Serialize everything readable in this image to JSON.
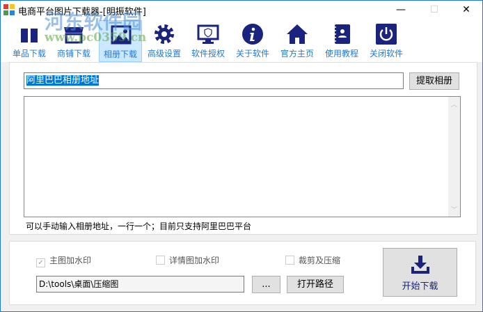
{
  "window": {
    "title": "电商平台图片下载器-[明振软件]",
    "minimize": "—",
    "maximize": "☐",
    "close": "✕"
  },
  "toolbar": [
    {
      "label": "单品下载",
      "icon": "box-icon"
    },
    {
      "label": "商铺下载",
      "icon": "store-icon"
    },
    {
      "label": "相册下载",
      "icon": "image-icon",
      "selected": true
    },
    {
      "label": "高级设置",
      "icon": "gear-icon"
    },
    {
      "label": "软件授权",
      "icon": "monitor-shield-icon"
    },
    {
      "label": "关于软件",
      "icon": "info-icon"
    },
    {
      "label": "官方主页",
      "icon": "home-icon"
    },
    {
      "label": "使用教程",
      "icon": "notebook-icon"
    },
    {
      "label": "关闭软件",
      "icon": "power-icon"
    }
  ],
  "album": {
    "url_value": "阿里巴巴相册地址",
    "fetch_button": "提取相册",
    "list_text": "",
    "hint": "可以手动输入相册地址，一行一个；目前只支持阿里巴巴平台"
  },
  "options": {
    "main_watermark": {
      "label": "主图加水印",
      "checked": true
    },
    "detail_watermark": {
      "label": "详情图加水印",
      "checked": false
    },
    "crop_compress": {
      "label": "裁剪及压缩",
      "checked": false
    }
  },
  "path": {
    "value": "D:\\tools\\桌面\\压缩图",
    "browse_button": "...",
    "open_button": "打开路径"
  },
  "start_button": "开始下载",
  "watermark": {
    "name": "河东软件园",
    "url": "www.pc0359.cn"
  },
  "colors": {
    "accent": "#1e7ad8",
    "icon": "#1a237e",
    "selected": "#cce8ff"
  }
}
